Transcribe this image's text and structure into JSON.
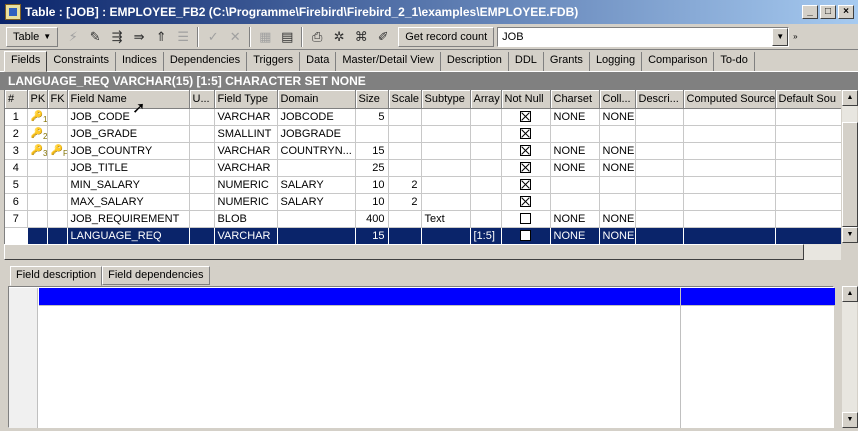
{
  "window": {
    "title": "Table : [JOB] : EMPLOYEE_FB2 (C:\\Programme\\Firebird\\Firebird_2_1\\examples\\EMPLOYEE.FDB)",
    "minimize": "_",
    "maximize": "□",
    "close": "×"
  },
  "toolbar": {
    "table_menu": "Table",
    "get_record_count": "Get record count",
    "table_select_value": "JOB"
  },
  "tabs": [
    {
      "label": "Fields",
      "active": true
    },
    {
      "label": "Constraints"
    },
    {
      "label": "Indices"
    },
    {
      "label": "Dependencies"
    },
    {
      "label": "Triggers"
    },
    {
      "label": "Data"
    },
    {
      "label": "Master/Detail View"
    },
    {
      "label": "Description"
    },
    {
      "label": "DDL"
    },
    {
      "label": "Grants"
    },
    {
      "label": "Logging"
    },
    {
      "label": "Comparison"
    },
    {
      "label": "To-do"
    }
  ],
  "field_info": "LANGUAGE_REQ VARCHAR(15) [1:5] CHARACTER SET NONE",
  "grid": {
    "columns": [
      "#",
      "PK",
      "FK",
      "Field Name",
      "U...",
      "Field Type",
      "Domain",
      "Size",
      "Scale",
      "Subtype",
      "Array",
      "Not Null",
      "Charset",
      "Coll...",
      "Descri...",
      "Computed Source",
      "Default Sou"
    ],
    "rows": [
      {
        "n": "1",
        "pk": "1",
        "fk": "",
        "name": "JOB_CODE",
        "type": "VARCHAR",
        "domain": "JOBCODE",
        "size": "5",
        "scale": "",
        "subtype": "",
        "array": "",
        "notnull": true,
        "charset": "NONE",
        "coll": "NONE"
      },
      {
        "n": "2",
        "pk": "2",
        "fk": "",
        "name": "JOB_GRADE",
        "type": "SMALLINT",
        "domain": "JOBGRADE",
        "size": "",
        "scale": "",
        "subtype": "",
        "array": "",
        "notnull": true,
        "charset": "",
        "coll": ""
      },
      {
        "n": "3",
        "pk": "3",
        "fk": "F",
        "name": "JOB_COUNTRY",
        "type": "VARCHAR",
        "domain": "COUNTRYN...",
        "size": "15",
        "scale": "",
        "subtype": "",
        "array": "",
        "notnull": true,
        "charset": "NONE",
        "coll": "NONE"
      },
      {
        "n": "4",
        "pk": "",
        "fk": "",
        "name": "JOB_TITLE",
        "type": "VARCHAR",
        "domain": "",
        "size": "25",
        "scale": "",
        "subtype": "",
        "array": "",
        "notnull": true,
        "charset": "NONE",
        "coll": "NONE"
      },
      {
        "n": "5",
        "pk": "",
        "fk": "",
        "name": "MIN_SALARY",
        "type": "NUMERIC",
        "domain": "SALARY",
        "size": "10",
        "scale": "2",
        "subtype": "",
        "array": "",
        "notnull": true,
        "charset": "",
        "coll": ""
      },
      {
        "n": "6",
        "pk": "",
        "fk": "",
        "name": "MAX_SALARY",
        "type": "NUMERIC",
        "domain": "SALARY",
        "size": "10",
        "scale": "2",
        "subtype": "",
        "array": "",
        "notnull": true,
        "charset": "",
        "coll": ""
      },
      {
        "n": "7",
        "pk": "",
        "fk": "",
        "name": "JOB_REQUIREMENT",
        "type": "BLOB",
        "domain": "",
        "size": "400",
        "scale": "",
        "subtype": "Text",
        "array": "",
        "notnull": false,
        "charset": "NONE",
        "coll": "NONE"
      },
      {
        "n": "8",
        "pk": "",
        "fk": "",
        "name": "LANGUAGE_REQ",
        "type": "VARCHAR",
        "domain": "",
        "size": "15",
        "scale": "",
        "subtype": "",
        "array": "[1:5]",
        "notnull": false,
        "charset": "NONE",
        "coll": "NONE",
        "selected": true
      }
    ]
  },
  "bottom_tabs": [
    {
      "label": "Field description",
      "active": true
    },
    {
      "label": "Field dependencies"
    }
  ]
}
